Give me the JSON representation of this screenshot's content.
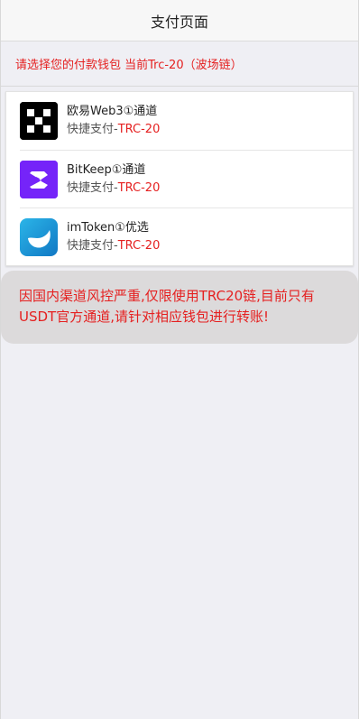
{
  "header": {
    "title": "支付页面"
  },
  "notice": {
    "text": "请选择您的付款钱包 当前Trc-20（波场链）"
  },
  "wallets": [
    {
      "name": "欧易Web3①通道",
      "sub_prefix": "快捷支付-",
      "sub_network": "TRC-20",
      "icon": "okx-icon"
    },
    {
      "name": "BitKeep①通道",
      "sub_prefix": "快捷支付-",
      "sub_network": "TRC-20",
      "icon": "bitkeep-icon"
    },
    {
      "name": "imToken①优选",
      "sub_prefix": "快捷支付-",
      "sub_network": "TRC-20",
      "icon": "imtoken-icon"
    }
  ],
  "warning": {
    "text": "因国内渠道风控严重,仅限使用TRC20链,目前只有USDT官方通道,请针对相应钱包进行转账!"
  },
  "colors": {
    "accent_red": "#e52020",
    "bitkeep_purple": "#7524f9",
    "imtoken_blue": "#1a9bd8"
  }
}
